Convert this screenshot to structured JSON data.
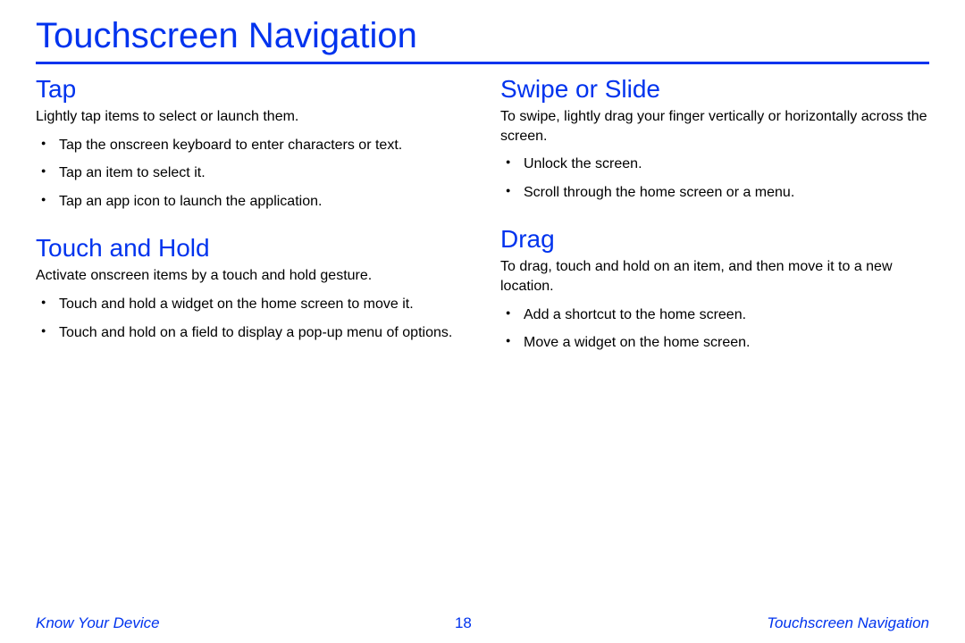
{
  "title": "Touchscreen Navigation",
  "left": {
    "tap": {
      "heading": "Tap",
      "desc": "Lightly tap items to select or launch them.",
      "items": [
        "Tap the onscreen keyboard to enter characters or text.",
        "Tap an item to select it.",
        "Tap an app icon to launch the application."
      ]
    },
    "touch_hold": {
      "heading": "Touch and Hold",
      "desc": "Activate onscreen items by a touch and hold gesture.",
      "items": [
        "Touch and hold a widget on the home screen to move it.",
        "Touch and hold on a field to display a pop-up menu of options."
      ]
    }
  },
  "right": {
    "swipe": {
      "heading": "Swipe or Slide",
      "desc": "To swipe, lightly drag your finger vertically or horizontally across the screen.",
      "items": [
        "Unlock the screen.",
        "Scroll through the home screen or a menu."
      ]
    },
    "drag": {
      "heading": "Drag",
      "desc": "To drag, touch and hold on an item, and then move it to a new location.",
      "items": [
        "Add a shortcut to the home screen.",
        "Move a widget on the home screen."
      ]
    }
  },
  "footer": {
    "left": "Know Your Device",
    "center": "18",
    "right": "Touchscreen Navigation"
  }
}
